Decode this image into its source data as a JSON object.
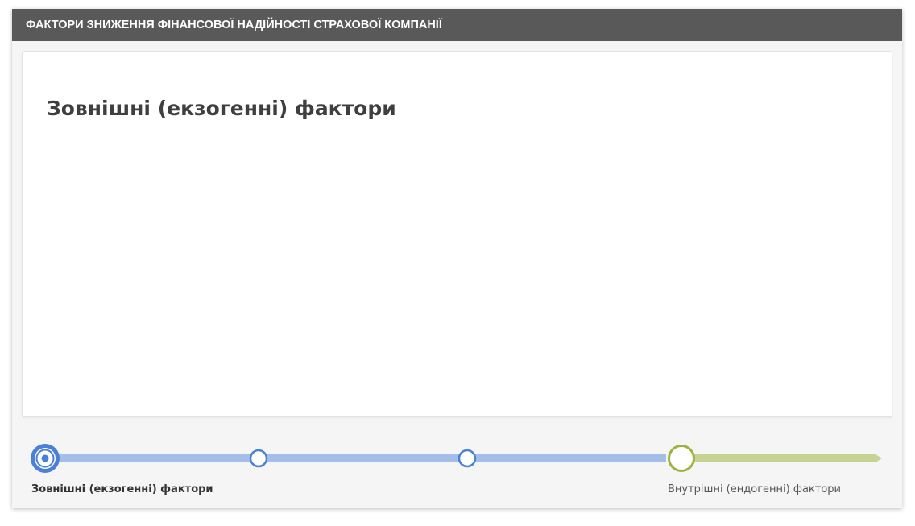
{
  "header": {
    "title": "ФАКТОРИ ЗНИЖЕННЯ ФІНАНСОВОЇ НАДІЙНОСТІ СТРАХОВОЇ КОМПАНІЇ"
  },
  "card": {
    "title": "Зовнішні (екзогенні) фактори"
  },
  "timeline": {
    "current_step": 1,
    "total_steps": 4,
    "start_label": "Зовнішні (екзогенні) фактори",
    "end_label": "Внутрішні (ендогенні) фактори",
    "colors": {
      "blue_track": "#a3bfe9",
      "blue_node": "#4a80d8",
      "green_track": "#c7d394",
      "green_node": "#a0b140",
      "header_bg": "#595959"
    }
  }
}
